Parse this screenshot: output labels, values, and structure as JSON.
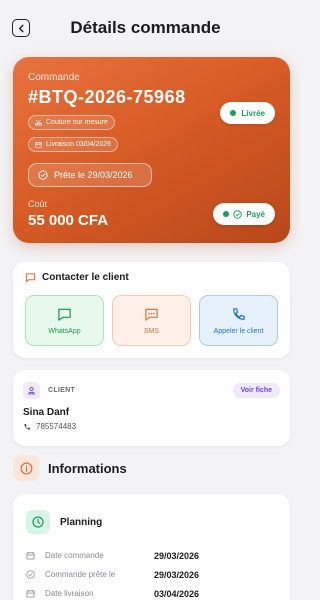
{
  "header": {
    "title": "Détails commande"
  },
  "order": {
    "label": "Commande",
    "code": "#BTQ-2026-75968",
    "type_chip": "Couture sur mesure",
    "delivery_chip": "Livraison 03/04/2026",
    "ready_chip": "Prête le 29/03/2026",
    "status": "Livrée",
    "cost_label": "Coût",
    "cost_value": "55 000 CFA",
    "payment_status": "Payé"
  },
  "contact": {
    "title": "Contacter le client",
    "actions": [
      {
        "label": "WhatsApp",
        "icon": "chat-icon"
      },
      {
        "label": "SMS",
        "icon": "sms-icon"
      },
      {
        "label": "Appeler le client",
        "icon": "phone-icon"
      }
    ]
  },
  "client": {
    "tag": "CLIENT",
    "view_label": "Voir fiche",
    "name": "Sina Danf",
    "phone": "785574483"
  },
  "info": {
    "title": "Informations"
  },
  "planning": {
    "title": "Planning",
    "rows": [
      {
        "label": "Date commande",
        "value": "29/03/2026",
        "icon": "calendar-icon"
      },
      {
        "label": "Commande prête le",
        "value": "29/03/2026",
        "icon": "check-circle-icon"
      },
      {
        "label": "Date livraison",
        "value": "03/04/2026",
        "icon": "calendar-icon"
      }
    ]
  },
  "colors": {
    "accent": "#e0692f",
    "success": "#1a9d5c",
    "whatsapp": "#1f9b4e",
    "sms": "#e0763f",
    "call": "#2a73c9",
    "client_tag": "#6a4ad0"
  }
}
